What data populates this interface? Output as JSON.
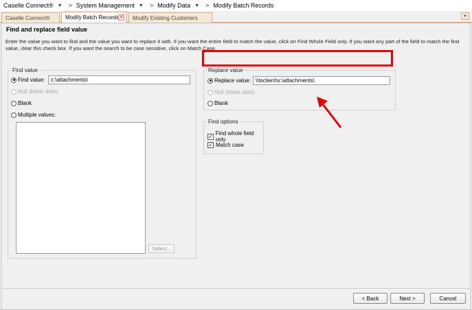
{
  "breadcrumb": {
    "items": [
      "Caselle Connect®",
      "System Management",
      "Modify Data",
      "Modify Batch Records"
    ]
  },
  "tabs": [
    {
      "label": "Caselle Connect®",
      "active": false
    },
    {
      "label": "Modify Batch Records",
      "active": true,
      "close": "✕"
    },
    {
      "label": "Modify Existing Customers",
      "active": false
    }
  ],
  "page": {
    "heading": "Find and replace field value",
    "instructions": "Enter the value you want to find and the value you want to replace it with.  If you want the entire field to match the value, click on Find Whole Field only.  If you want any part of the field to match the find value, clear this check box.  If you want the search to be case sensitive, click on Match Case."
  },
  "find_value": {
    "group_label": "Find value",
    "find_label": "Find value:",
    "find_input": "c:\\attachments\\",
    "null_label": "Null (blank date)",
    "blank_label": "Blank",
    "multiple_label": "Multiple values:",
    "select_button": "Select...",
    "selected_option": "find"
  },
  "replace_value": {
    "group_label": "Replace value",
    "replace_label": "Replace value:",
    "replace_input": "\\\\tsclient\\s:\\attachments\\",
    "null_label": "Null (blank date)",
    "blank_label": "Blank",
    "selected_option": "replace"
  },
  "find_options": {
    "group_label": "Find options",
    "whole_field_label": "Find whole field only",
    "whole_field_checked": true,
    "match_case_label": "Match case",
    "match_case_checked": true
  },
  "footer": {
    "back_label": "< Back",
    "next_label": "Next >",
    "cancel_label": "Cancel"
  },
  "colors": {
    "highlight": "#e60000",
    "arrow": "#e60000",
    "tab_active_border": "#d8a070"
  }
}
